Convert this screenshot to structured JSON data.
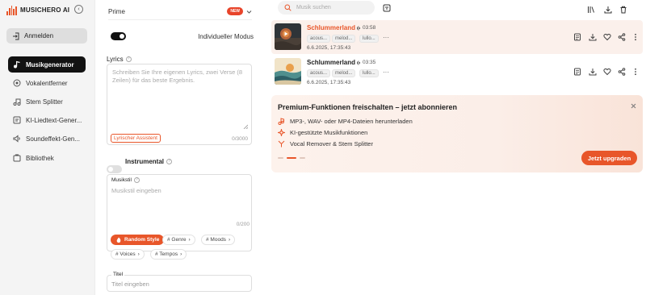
{
  "app": {
    "logo_text": "MUSICHERO AI",
    "accent_color": "#e8562a"
  },
  "sidebar": {
    "login_label": "Anmelden",
    "items": [
      {
        "label": "Musikgenerator",
        "icon": "music-note-icon",
        "active": true
      },
      {
        "label": "Vokalentferner",
        "icon": "vocal-remover-icon"
      },
      {
        "label": "Stem Splitter",
        "icon": "stem-splitter-icon"
      },
      {
        "label": "KI-Liedtext-Gener...",
        "icon": "lyrics-icon"
      },
      {
        "label": "Soundeffekt-Gen...",
        "icon": "sound-effect-icon"
      },
      {
        "label": "Bibliothek",
        "icon": "library-icon"
      }
    ]
  },
  "form": {
    "model_label": "Prime",
    "new_badge": "NEW",
    "custom_mode_label": "Individueller Modus",
    "custom_mode_on": true,
    "lyrics_label": "Lyrics",
    "lyrics_placeholder": "Schreiben Sie Ihre eigenen Lyrics, zwei Verse (8 Zeilen) für das beste Ergebnis.",
    "lyrics_assistant": "Lyrischer Assistent",
    "lyrics_counter": "0/3000",
    "instrumental_label": "Instrumental",
    "instrumental_on": false,
    "style_label": "Musikstil",
    "style_placeholder": "Musikstil eingeben",
    "style_counter": "0/200",
    "style_buttons": {
      "random": "Random Style",
      "genre": "# Genre",
      "moods": "# Moods",
      "voices": "# Voices",
      "tempos": "# Tempos"
    },
    "title_label": "Titel",
    "title_placeholder": "Titel eingeben"
  },
  "main": {
    "search_placeholder": "Musik suchen",
    "songs": [
      {
        "title": "Schlummerland",
        "duration": "03:58",
        "tags": [
          "acous...",
          "melod...",
          "lullo..."
        ],
        "more": "···",
        "date": "6.6.2025, 17:35:43",
        "selected": true,
        "title_color": "#e8562a"
      },
      {
        "title": "Schlummerland",
        "duration": "03:35",
        "tags": [
          "acous...",
          "melod...",
          "lullo..."
        ],
        "more": "···",
        "date": "6.6.2025, 17:35:43",
        "selected": false,
        "title_color": "#222222"
      }
    ],
    "promo": {
      "title": "Premium-Funktionen freischalten – jetzt abonnieren",
      "features": [
        "MP3-, WAV- oder MP4-Dateien herunterladen",
        "KI-gestützte Musikfunktionen",
        "Vocal Remover & Stem Splitter"
      ],
      "cta": "Jetzt upgraden"
    }
  }
}
